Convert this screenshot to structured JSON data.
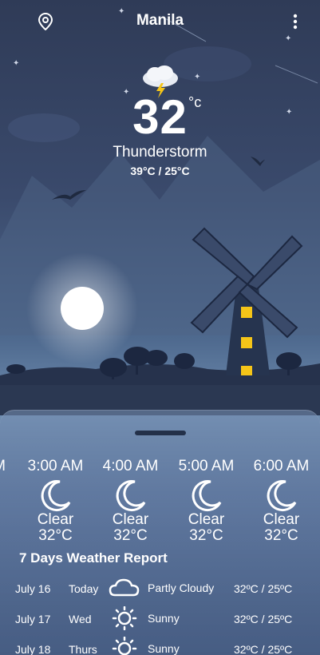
{
  "header": {
    "city": "Manila",
    "location_icon": "location-pin-icon",
    "menu_icon": "more-vertical-icon"
  },
  "current": {
    "icon": "thunderstorm-cloud-icon",
    "temperature": "32",
    "unit": "°c",
    "condition": "Thunderstorm",
    "high_low": "39°C / 25°C"
  },
  "hourly": [
    {
      "time": "3:00 AM",
      "condition": "Clear",
      "temp": "32°C",
      "icon": "moon-icon"
    },
    {
      "time": "4:00 AM",
      "condition": "Clear",
      "temp": "32°C",
      "icon": "moon-icon"
    },
    {
      "time": "5:00 AM",
      "condition": "Clear",
      "temp": "32°C",
      "icon": "moon-icon"
    },
    {
      "time": "6:00 AM",
      "condition": "Clear",
      "temp": "32°C",
      "icon": "moon-icon"
    }
  ],
  "hourly_partial_left": "M",
  "weekly": {
    "title": "7 Days Weather Report",
    "days": [
      {
        "date": "July 16",
        "day": "Today",
        "condition": "Partly Cloudy",
        "temps": "32ºC / 25ºC",
        "icon": "cloud-icon"
      },
      {
        "date": "July 17",
        "day": "Wed",
        "condition": "Sunny",
        "temps": "32ºC / 25ºC",
        "icon": "sun-icon"
      },
      {
        "date": "July 18",
        "day": "Thurs",
        "condition": "Sunny",
        "temps": "32ºC / 25ºC",
        "icon": "sun-icon"
      }
    ]
  },
  "colors": {
    "sky_top": "#2f3b57",
    "moon_glow": "#ffffff",
    "windmill_window": "#f5c518",
    "panel": "#6f8db0"
  }
}
